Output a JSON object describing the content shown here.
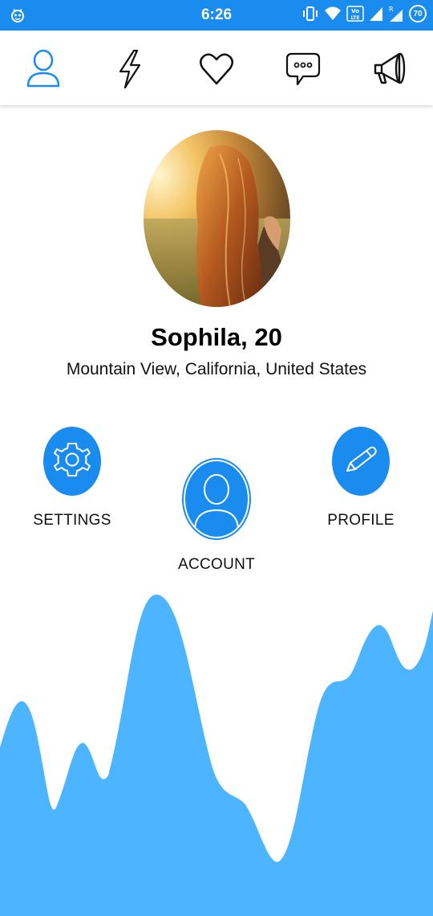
{
  "status_bar": {
    "time": "6:26",
    "battery": "70",
    "bg_color": "#1a8cf0"
  },
  "nav": {
    "items": [
      {
        "icon": "user-icon",
        "active": true
      },
      {
        "icon": "lightning-icon",
        "active": false
      },
      {
        "icon": "heart-icon",
        "active": false
      },
      {
        "icon": "chat-icon",
        "active": false
      },
      {
        "icon": "megaphone-icon",
        "active": false
      }
    ]
  },
  "profile": {
    "name": "Sophila, 20",
    "location": "Mountain View, California, United States"
  },
  "actions": {
    "settings_label": "SETTINGS",
    "account_label": "ACCOUNT",
    "profile_label": "PROFILE"
  },
  "colors": {
    "accent": "#1a8cf0",
    "wave": "#4db5ff"
  }
}
